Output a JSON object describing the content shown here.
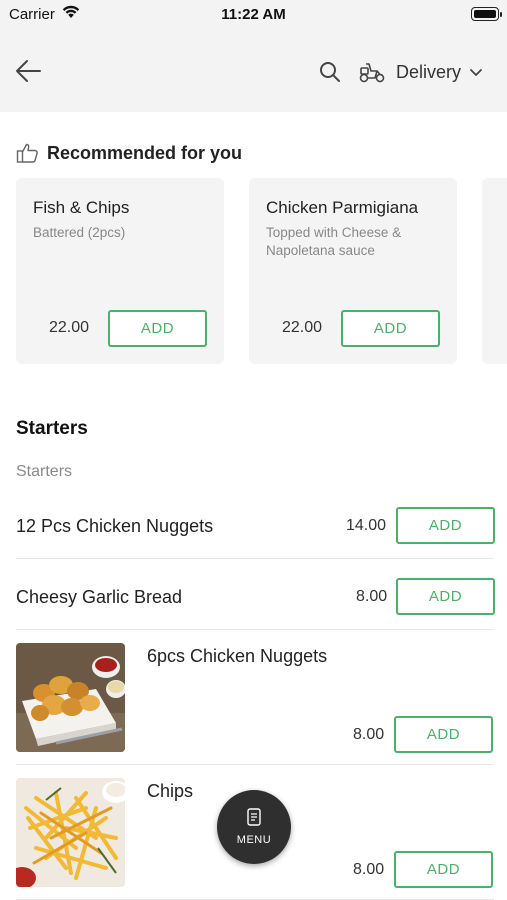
{
  "status_bar": {
    "carrier": "Carrier",
    "time": "11:22 AM"
  },
  "header": {
    "delivery_label": "Delivery"
  },
  "recommended": {
    "title": "Recommended for you",
    "items": [
      {
        "name": "Fish & Chips",
        "description": "Battered (2pcs)",
        "price": "22.00",
        "add_label": "ADD"
      },
      {
        "name": "Chicken Parmigiana",
        "description": "Topped with Cheese & Napoletana sauce",
        "price": "22.00",
        "add_label": "ADD"
      }
    ]
  },
  "section": {
    "title": "Starters",
    "subtitle": "Starters",
    "items": [
      {
        "name": "12 Pcs Chicken Nuggets",
        "price": "14.00",
        "add_label": "ADD"
      },
      {
        "name": "Cheesy Garlic Bread",
        "price": "8.00",
        "add_label": "ADD"
      },
      {
        "name": "6pcs Chicken Nuggets",
        "price": "8.00",
        "add_label": "ADD"
      },
      {
        "name": "Chips",
        "price": "8.00",
        "add_label": "ADD"
      }
    ]
  },
  "fab": {
    "label": "MENU"
  },
  "colors": {
    "accent": "#4caf6a",
    "header_bg": "#f3f3f3",
    "card_bg": "#f4f4f4",
    "fab_bg": "#2f2f2f"
  }
}
